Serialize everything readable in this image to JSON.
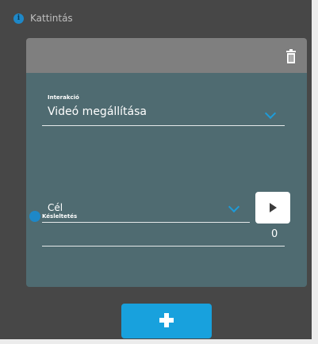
{
  "header": {
    "label": "Kattintás",
    "info_icon": "info-icon"
  },
  "card": {
    "delete_icon": "trash-icon",
    "interaction": {
      "label": "Interakció",
      "value": "Videó megállítása",
      "icon": "chevron-down-icon"
    },
    "target": {
      "value": "Cél",
      "icon": "chevron-down-icon",
      "action_icon": "play-icon"
    },
    "delay": {
      "label": "Késleltetés",
      "value": "0",
      "info_icon": "info-icon"
    }
  },
  "add_button": {
    "icon": "plus-icon"
  },
  "colors": {
    "accent": "#1e9bd8",
    "card_body": "#4f6b71",
    "card_header": "#7f7f7f",
    "background": "#474747"
  }
}
